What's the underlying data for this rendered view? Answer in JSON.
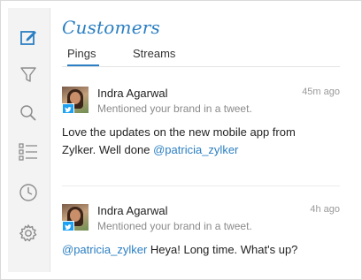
{
  "header": {
    "title": "Customers"
  },
  "tabs": [
    {
      "label": "Pings",
      "active": true
    },
    {
      "label": "Streams",
      "active": false
    }
  ],
  "sidebar": {
    "icons": [
      "compose-icon",
      "filter-icon",
      "search-icon",
      "list-icon",
      "clock-icon",
      "gear-icon"
    ],
    "active_color": "#2b7fc2"
  },
  "pings": [
    {
      "name": "Indra Agarwal",
      "time": "45m ago",
      "subtitle": "Mentioned your brand in a tweet.",
      "text_before": "Love the updates on the new mobile app from Zylker. Well done ",
      "mention": "@patricia_zylker",
      "text_after": ""
    },
    {
      "name": "Indra Agarwal",
      "time": "4h ago",
      "subtitle": "Mentioned your brand in a tweet.",
      "text_before": "",
      "mention": "@patricia_zylker",
      "text_after": " Heya! Long time. What's up?"
    }
  ],
  "colors": {
    "accent": "#2b7fc2",
    "twitter": "#1da1f2"
  }
}
